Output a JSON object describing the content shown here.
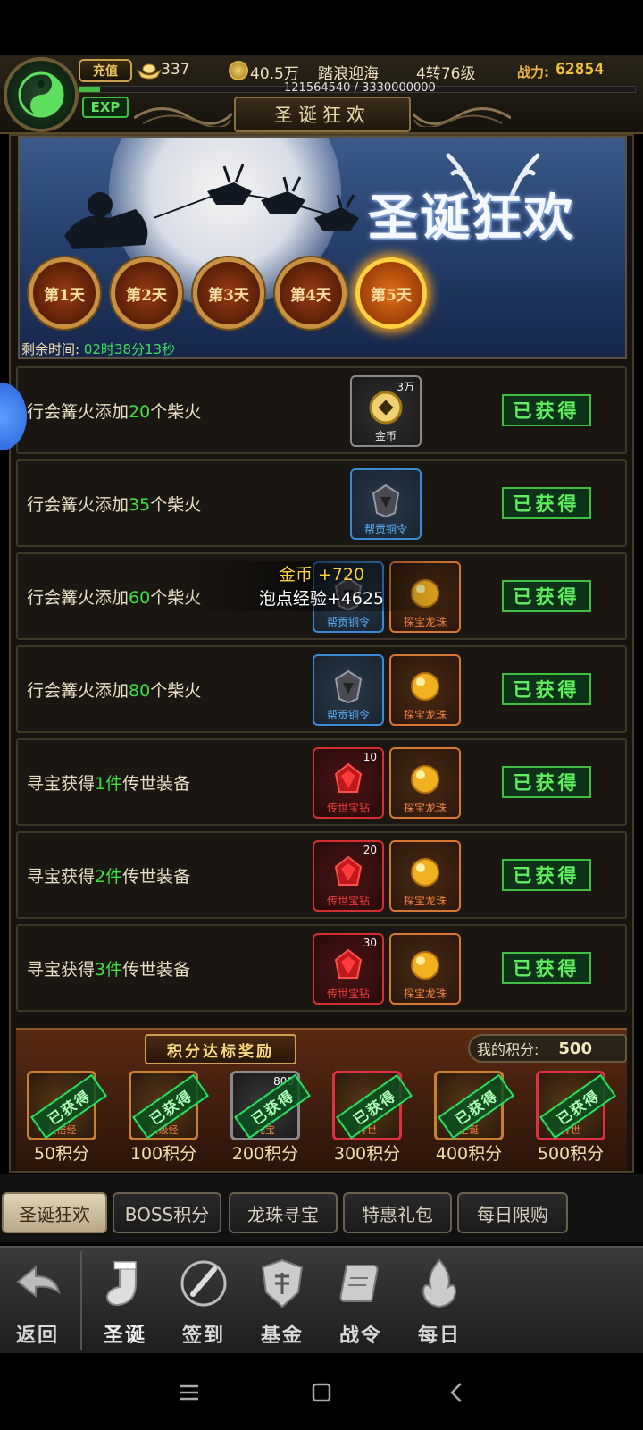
{
  "header": {
    "recharge_label": "充值",
    "ingot_value": "337",
    "coin_value": "40.5万",
    "player_name": "踏浪迎海",
    "player_level": "4转76级",
    "power_label": "战力:",
    "power_value": "62854",
    "exp_text": "121564540 / 3330000000",
    "exp_progress": 0.0365,
    "exp_badge": "EXP",
    "page_title": "圣诞狂欢"
  },
  "banner": {
    "title": "圣诞狂欢",
    "days": [
      "第1天",
      "第2天",
      "第3天",
      "第4天",
      "第5天"
    ],
    "active_day_index": 4,
    "remain_label": "剩余时间:",
    "remain_value": "02时38分13秒"
  },
  "tasks": [
    {
      "prefix": "行会篝火添加",
      "num": "20",
      "suffix": "个柴火",
      "items": [
        {
          "name": "金币",
          "qty": "3万",
          "rarity": "gray",
          "icon": "coin-icon"
        }
      ],
      "status": "已获得"
    },
    {
      "prefix": "行会篝火添加",
      "num": "35",
      "suffix": "个柴火",
      "items": [
        {
          "name": "帮贡铜令",
          "qty": "",
          "rarity": "blue",
          "icon": "token-icon"
        }
      ],
      "status": "已获得"
    },
    {
      "prefix": "行会篝火添加",
      "num": "60",
      "suffix": "个柴火",
      "items": [
        {
          "name": "帮贡铜令",
          "qty": "",
          "rarity": "blue",
          "icon": "token-icon"
        },
        {
          "name": "探宝龙珠",
          "qty": "",
          "rarity": "orange",
          "icon": "dragon-pearl-icon"
        }
      ],
      "status": "已获得"
    },
    {
      "prefix": "行会篝火添加",
      "num": "80",
      "suffix": "个柴火",
      "items": [
        {
          "name": "帮贡铜令",
          "qty": "",
          "rarity": "blue",
          "icon": "token-icon"
        },
        {
          "name": "探宝龙珠",
          "qty": "",
          "rarity": "orange",
          "icon": "dragon-pearl-icon"
        }
      ],
      "status": "已获得"
    },
    {
      "prefix": "寻宝获得",
      "num": "1件",
      "suffix": "传世装备",
      "items": [
        {
          "name": "传世宝钻",
          "qty": "10",
          "rarity": "red",
          "icon": "gem-icon"
        },
        {
          "name": "探宝龙珠",
          "qty": "",
          "rarity": "orange",
          "icon": "dragon-pearl-icon"
        }
      ],
      "status": "已获得"
    },
    {
      "prefix": "寻宝获得",
      "num": "2件",
      "suffix": "传世装备",
      "items": [
        {
          "name": "传世宝钻",
          "qty": "20",
          "rarity": "red",
          "icon": "gem-icon"
        },
        {
          "name": "探宝龙珠",
          "qty": "",
          "rarity": "orange",
          "icon": "dragon-pearl-icon"
        }
      ],
      "status": "已获得"
    },
    {
      "prefix": "寻宝获得",
      "num": "3件",
      "suffix": "传世装备",
      "items": [
        {
          "name": "传世宝钻",
          "qty": "30",
          "rarity": "red",
          "icon": "gem-icon"
        },
        {
          "name": "探宝龙珠",
          "qty": "",
          "rarity": "orange",
          "icon": "dragon-pearl-icon"
        }
      ],
      "status": "已获得"
    }
  ],
  "floating_text": {
    "line1": "金币  +720",
    "line2": "泡点经验+4625"
  },
  "points": {
    "title": "积分达标奖励",
    "my_points_label": "我的积分:",
    "my_points_value": "500",
    "rewards": [
      {
        "pts": "50积分",
        "name": "双倍经",
        "qty": "",
        "frame": "orange",
        "stamp": "已获得"
      },
      {
        "pts": "100积分",
        "name": "高级经",
        "qty": "",
        "frame": "orange",
        "stamp": "已获得"
      },
      {
        "pts": "200积分",
        "name": "元宝",
        "qty": "800",
        "frame": "gray",
        "stamp": "已获得"
      },
      {
        "pts": "300积分",
        "name": "传世",
        "qty": "",
        "frame": "red",
        "stamp": "已获得"
      },
      {
        "pts": "400积分",
        "name": "圣诞",
        "qty": "",
        "frame": "orange",
        "stamp": "已获得"
      },
      {
        "pts": "500积分",
        "name": "传世",
        "qty": "",
        "frame": "red",
        "stamp": "已获得"
      }
    ]
  },
  "tabs": [
    "圣诞狂欢",
    "BOSS积分",
    "龙珠寻宝",
    "特惠礼包",
    "每日限购"
  ],
  "active_tab_index": 0,
  "nav": {
    "back": "返回",
    "items": [
      "圣诞",
      "签到",
      "基金",
      "战令",
      "每日"
    ]
  },
  "colors": {
    "highlight_green": "#3fdf3f",
    "gold": "#f0c040",
    "obtained_green": "#5fef5f"
  }
}
